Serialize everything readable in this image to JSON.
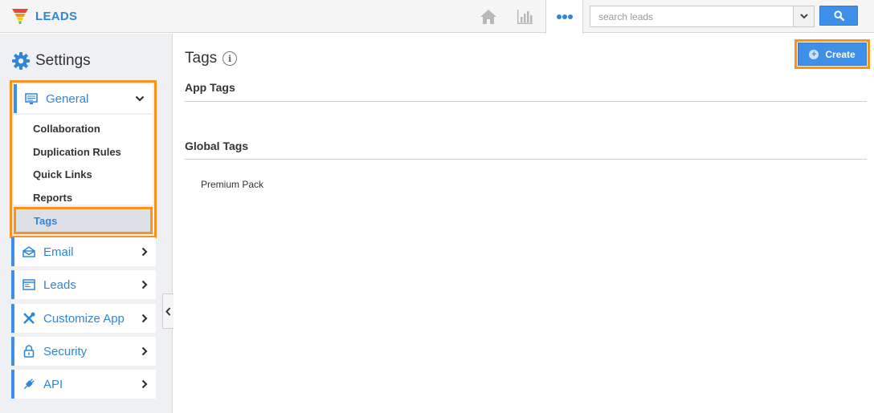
{
  "app": {
    "name": "LEADS"
  },
  "topbar": {
    "icons": [
      "home-icon",
      "chart-icon",
      "more-icon"
    ],
    "search": {
      "placeholder": "search leads",
      "value": ""
    }
  },
  "sidebar": {
    "title": "Settings",
    "sections": [
      {
        "label": "General",
        "icon": "monitor-icon",
        "expanded": true,
        "items": [
          "Collaboration",
          "Duplication Rules",
          "Quick Links",
          "Reports",
          "Tags"
        ],
        "selected": "Tags"
      },
      {
        "label": "Email",
        "icon": "envelope-icon"
      },
      {
        "label": "Leads",
        "icon": "window-icon"
      },
      {
        "label": "Customize App",
        "icon": "tools-icon"
      },
      {
        "label": "Security",
        "icon": "lock-icon"
      },
      {
        "label": "API",
        "icon": "plug-icon"
      }
    ]
  },
  "main": {
    "title": "Tags",
    "create_label": "Create",
    "app_tags_title": "App Tags",
    "global_tags_title": "Global Tags",
    "global_tags": [
      "Premium Pack"
    ]
  },
  "colors": {
    "accent": "#3d8fe8",
    "highlight": "#f7941d",
    "link": "#2f86d8"
  }
}
